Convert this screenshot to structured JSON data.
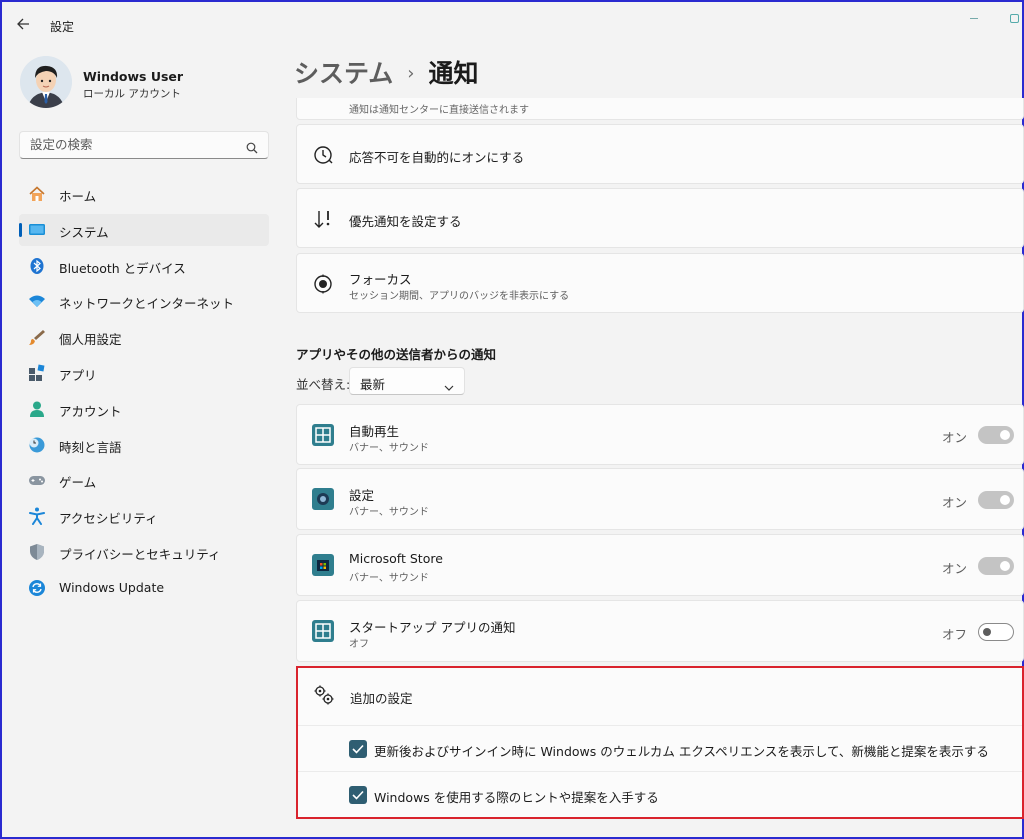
{
  "window": {
    "title": "設定"
  },
  "profile": {
    "name": "Windows User",
    "account_type": "ローカル アカウント"
  },
  "search": {
    "placeholder": "設定の検索"
  },
  "sidebar": {
    "items": [
      {
        "label": "ホーム",
        "icon": "home-icon"
      },
      {
        "label": "システム",
        "icon": "system-icon",
        "active": true
      },
      {
        "label": "Bluetooth とデバイス",
        "icon": "bluetooth-icon"
      },
      {
        "label": "ネットワークとインターネット",
        "icon": "wifi-icon"
      },
      {
        "label": "個人用設定",
        "icon": "brush-icon"
      },
      {
        "label": "アプリ",
        "icon": "apps-icon"
      },
      {
        "label": "アカウント",
        "icon": "account-icon"
      },
      {
        "label": "時刻と言語",
        "icon": "clock-globe-icon"
      },
      {
        "label": "ゲーム",
        "icon": "gamepad-icon"
      },
      {
        "label": "アクセシビリティ",
        "icon": "accessibility-icon"
      },
      {
        "label": "プライバシーとセキュリティ",
        "icon": "shield-icon"
      },
      {
        "label": "Windows Update",
        "icon": "update-icon"
      }
    ]
  },
  "header": {
    "crumb": "システム",
    "separator": "›",
    "title": "通知"
  },
  "top_cards": {
    "cut_text": "通知は通知センターに直接送信されます",
    "dnd_auto": {
      "title": "応答不可を自動的にオンにする",
      "icon": "clock-schedule-icon"
    },
    "priority": {
      "title": "優先通知を設定する",
      "icon": "priority-sort-icon"
    },
    "focus": {
      "title": "フォーカス",
      "subtitle": "セッション期間、アプリのバッジを非表示にする",
      "icon": "focus-icon"
    }
  },
  "apps_section": {
    "heading": "アプリやその他の送信者からの通知",
    "sort_label": "並べ替え:",
    "sort_value": "最新",
    "apps": [
      {
        "name": "自動再生",
        "detail": "バナー、サウンド",
        "state_label": "オン",
        "on": true,
        "icon": "autoplay-icon"
      },
      {
        "name": "設定",
        "detail": "バナー、サウンド",
        "state_label": "オン",
        "on": true,
        "icon": "settings-app-icon"
      },
      {
        "name": "Microsoft Store",
        "detail": "バナー、サウンド",
        "state_label": "オン",
        "on": true,
        "icon": "store-icon"
      },
      {
        "name": "スタートアップ アプリの通知",
        "detail": "オフ",
        "state_label": "オフ",
        "on": false,
        "icon": "startup-apps-icon"
      }
    ]
  },
  "additional": {
    "title": "追加の設定",
    "options": [
      {
        "label": "更新後およびサインイン時に Windows のウェルカム エクスペリエンスを表示して、新機能と提案を表示する",
        "checked": true
      },
      {
        "label": "Windows を使用する際のヒントや提案を入手する",
        "checked": true
      }
    ]
  },
  "colors": {
    "accent": "#005fb8",
    "highlight_border": "#d9232d",
    "checkbox": "#2f5e72",
    "app_icon_bg": "#2f7e8e"
  }
}
